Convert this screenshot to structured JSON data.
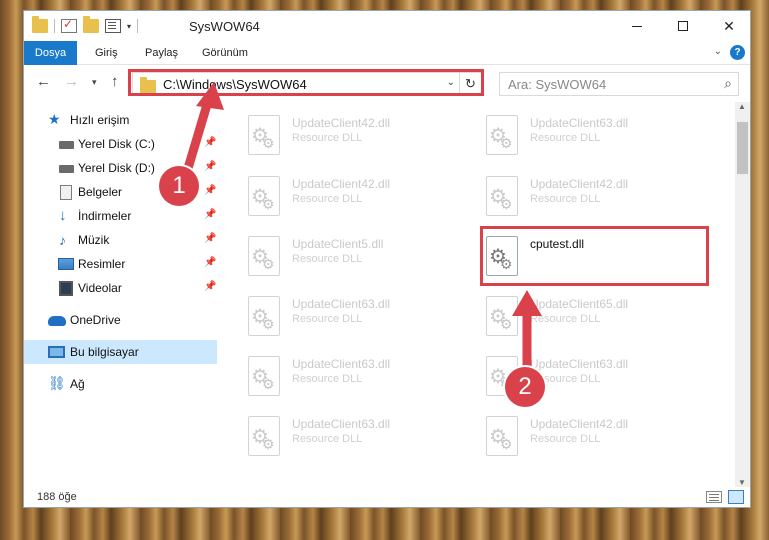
{
  "window": {
    "title": "SysWOW64",
    "controls": {
      "minimize": "—",
      "maximize": "☐",
      "close": "✕"
    }
  },
  "ribbon": {
    "tabs": [
      "Dosya",
      "Giriş",
      "Paylaş",
      "Görünüm"
    ]
  },
  "address": {
    "path": "C:\\Windows\\SysWOW64",
    "search_placeholder": "Ara: SysWOW64"
  },
  "nav": {
    "quick_access": "Hızlı erişim",
    "items": [
      {
        "label": "Yerel Disk (C:)",
        "icon": "drive-icon",
        "pinned": true
      },
      {
        "label": "Yerel Disk (D:)",
        "icon": "drive-icon",
        "pinned": true
      },
      {
        "label": "Belgeler",
        "icon": "documents-icon",
        "pinned": true
      },
      {
        "label": "İndirmeler",
        "icon": "download-icon",
        "pinned": true
      },
      {
        "label": "Müzik",
        "icon": "music-icon",
        "pinned": true
      },
      {
        "label": "Resimler",
        "icon": "pictures-icon",
        "pinned": true
      },
      {
        "label": "Videolar",
        "icon": "videos-icon",
        "pinned": true
      }
    ],
    "onedrive": "OneDrive",
    "this_pc": "Bu bilgisayar",
    "network": "Ağ"
  },
  "files": [
    {
      "name": "UpdateClient42.dll",
      "type": "Resource DLL"
    },
    {
      "name": "UpdateClient63.dll",
      "type": "Resource DLL"
    },
    {
      "name": "UpdateClient42.dll",
      "type": "Resource DLL"
    },
    {
      "name": "UpdateClient42.dll",
      "type": "Resource DLL"
    },
    {
      "name": "UpdateClient5.dll",
      "type": "Resource DLL"
    },
    {
      "name": "cputest.dll",
      "type": ""
    },
    {
      "name": "UpdateClient63.dll",
      "type": "Resource DLL"
    },
    {
      "name": "UpdateClient65.dll",
      "type": "Resource DLL"
    },
    {
      "name": "UpdateClient63.dll",
      "type": "Resource DLL"
    },
    {
      "name": "UpdateClient63.dll",
      "type": "Resource DLL"
    },
    {
      "name": "UpdateClient63.dll",
      "type": "Resource DLL"
    },
    {
      "name": "UpdateClient42.dll",
      "type": "Resource DLL"
    }
  ],
  "status": {
    "count": "188 öğe"
  },
  "annotations": {
    "step1": "1",
    "step2": "2",
    "color": "#d9424b"
  }
}
